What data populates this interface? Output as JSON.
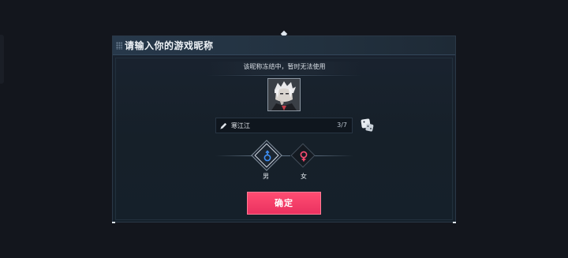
{
  "dialog": {
    "title": "请输入你的游戏昵称",
    "notice": "该昵称冻结中，暂时无法使用",
    "avatar_icon": "character-portrait",
    "name_field": {
      "value": "寒江江",
      "count": "3/7",
      "edit_icon": "pencil-icon"
    },
    "random_icon": "dice-icon",
    "genders": [
      {
        "label": "男",
        "icon": "male-symbol-icon",
        "selected": true,
        "color": "#3f8ff5"
      },
      {
        "label": "女",
        "icon": "female-symbol-icon",
        "selected": false,
        "color": "#ff4d72"
      }
    ],
    "confirm_label": "确定",
    "accent_color": "#ff4d72"
  }
}
